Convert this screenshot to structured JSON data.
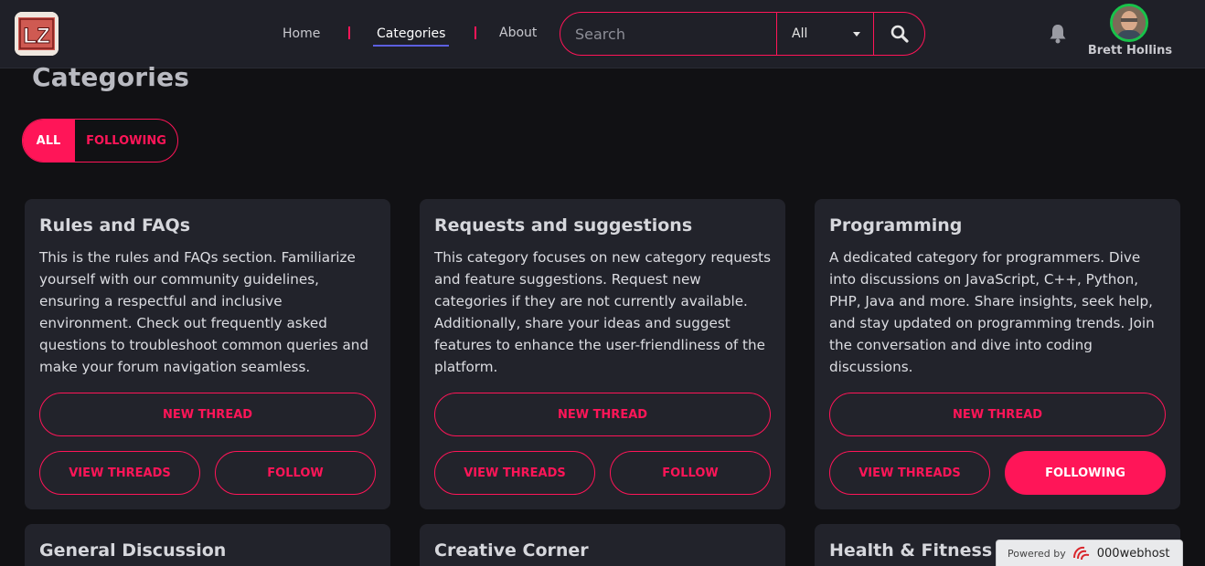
{
  "header": {
    "logo_text": "LZ",
    "nav": [
      {
        "label": "Home"
      },
      {
        "label": "Categories"
      },
      {
        "label": "About"
      }
    ],
    "search": {
      "placeholder": "Search",
      "scope": "All"
    },
    "user": {
      "name": "Brett Hollins"
    }
  },
  "main": {
    "title": "Categories",
    "filter": {
      "all": "ALL",
      "following": "FOLLOWING"
    },
    "cards": [
      {
        "title": "Rules and FAQs",
        "description": "This is the rules and FAQs section. Familiarize yourself with our community guidelines, ensuring a respectful and inclusive environment. Check out frequently asked questions to troubleshoot common queries and make your forum navigation seamless.",
        "new_thread": "NEW THREAD",
        "view_threads": "VIEW THREADS",
        "follow": "FOLLOW"
      },
      {
        "title": "Requests and suggestions",
        "description": "This category focuses on new category requests and feature suggestions. Request new categories if they are not currently available. Additionally, share your ideas and suggest features to enhance the user-friendliness of the platform.",
        "new_thread": "NEW THREAD",
        "view_threads": "VIEW THREADS",
        "follow": "FOLLOW"
      },
      {
        "title": "Programming",
        "description": "A dedicated category for programmers. Dive into discussions on JavaScript, C++, Python, PHP, Java and more. Share insights, seek help, and stay updated on programming trends. Join the conversation and dive into coding discussions.",
        "new_thread": "NEW THREAD",
        "view_threads": "VIEW THREADS",
        "follow": "FOLLOWING"
      },
      {
        "title": "General Discussion"
      },
      {
        "title": "Creative Corner"
      },
      {
        "title": "Health & Fitness"
      }
    ]
  },
  "footer_badge": {
    "label": "Powered by",
    "brand": "000webhost"
  },
  "colors": {
    "accent": "#ff1558",
    "header_bg": "#1f2028",
    "card_bg": "#22232b",
    "page_bg": "#111114"
  }
}
